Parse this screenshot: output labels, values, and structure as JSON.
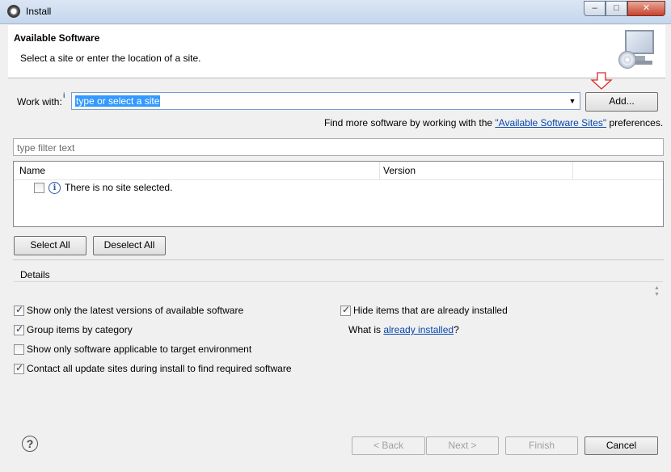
{
  "window": {
    "title": "Install",
    "app_icon": "eclipse-gear-icon",
    "controls": {
      "minimize": "–",
      "maximize": "□",
      "close": "✕"
    }
  },
  "header": {
    "title": "Available Software",
    "subtitle": "Select a site or enter the location of a site.",
    "illustration": "monitor-with-cd-icon"
  },
  "work_with": {
    "label": "Work with:",
    "value": "type or select a site",
    "add_button": "Add..."
  },
  "find_more": {
    "prefix": "Find more software by working with the ",
    "link": "\"Available Software Sites\"",
    "suffix": " preferences."
  },
  "filter": {
    "placeholder": "type filter text"
  },
  "table": {
    "columns": [
      "Name",
      "Version"
    ],
    "rows": [
      {
        "checked": false,
        "icon": "info-icon",
        "text": "There is no site selected."
      }
    ]
  },
  "selection_buttons": {
    "select_all": "Select All",
    "deselect_all": "Deselect All"
  },
  "details": {
    "label": "Details"
  },
  "options": [
    {
      "label": "Show only the latest versions of available software",
      "checked": true
    },
    {
      "label": "Group items by category",
      "checked": true
    },
    {
      "label": "Show only software applicable to target environment",
      "checked": false
    },
    {
      "label": "Contact all update sites during install to find required software",
      "checked": true
    },
    {
      "label": "Hide items that are already installed",
      "checked": true
    }
  ],
  "what_is": {
    "prefix": "What is ",
    "link": "already installed",
    "suffix": "?"
  },
  "footer": {
    "help_icon": "help-question-icon",
    "back": "< Back",
    "next": "Next >",
    "finish": "Finish",
    "cancel": "Cancel"
  },
  "colors": {
    "selection": "#3399ff",
    "link": "#0645ad",
    "close_button": "#c7432e",
    "arrow_indicator": "#d62b2b"
  }
}
